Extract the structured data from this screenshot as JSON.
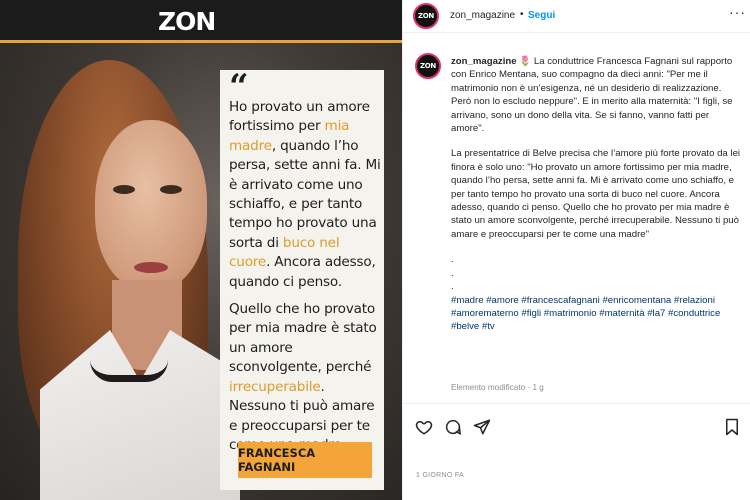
{
  "image": {
    "brand": "ZON",
    "quote_paragraph1": [
      {
        "t": "Ho provato un amore fortissimo per ",
        "hl": false
      },
      {
        "t": "mia madre",
        "hl": true
      },
      {
        "t": ", quando l’ho persa, sette anni fa. Mi è arrivato come uno schiaffo, e per tanto tempo ho provato una sorta di ",
        "hl": false
      },
      {
        "t": "buco nel cuore",
        "hl": true
      },
      {
        "t": ". Ancora adesso, quando ci penso.",
        "hl": false
      }
    ],
    "quote_paragraph2": [
      {
        "t": "Quello che ho provato per mia madre è stato un amore sconvolgente, perché ",
        "hl": false
      },
      {
        "t": "irrecuperabile",
        "hl": true
      },
      {
        "t": ". Nessuno ti può amare e preoccuparsi per te come una madre.",
        "hl": false
      }
    ],
    "author": "FRANCESCA FAGNANI",
    "colors": {
      "accent": "#f3a53a",
      "highlight": "#e09a2a"
    }
  },
  "header": {
    "username": "zon_magazine",
    "separator": "•",
    "follow_label": "Segui",
    "more_icon": "more-horizontal-icon",
    "avatar_text": "ZON"
  },
  "caption": {
    "avatar_text": "ZON",
    "username": "zon_magazine",
    "emoji": "🌷",
    "paragraph1": "La conduttrice Francesca Fagnani sul rapporto con Enrico Mentana, suo compagno da dieci anni: \"Per me il matrimonio non è un’esigenza, né un desiderio di realizzazione. Però non lo escludo neppure\". E in merito alla maternità: \"I figli, se arrivano, sono un dono della vita. Se si fanno, vanno fatti per amore\".",
    "paragraph2": "La presentatrice di Belve precisa che l’amore più forte provato da lei finora è solo uno: \"Ho provato un amore fortissimo per mia madre, quando l’ho persa, sette anni fa. Mi è arrivato come uno schiaffo, e per tanto tempo ho provato una sorta di buco nel cuore. Ancora adesso, quando ci penso. Quello che ho provato per mia madre è stato un amore sconvolgente, perché irrecuperabile. Nessuno ti può amare e preoccuparsi per te come una madre\"",
    "dots": [
      ".",
      ".",
      "."
    ],
    "hashtags": "#madre #amore #francescafagnani #enricomentana #relazioni #amorematerno #figli #matrimonio #maternità #la7 #conduttrice #belve #tv",
    "edited": "Elemento modificato · 1 g"
  },
  "actions": {
    "icons": [
      "heart-icon",
      "comment-icon",
      "share-icon",
      "bookmark-icon"
    ],
    "timestamp": "1 GIORNO FA"
  }
}
